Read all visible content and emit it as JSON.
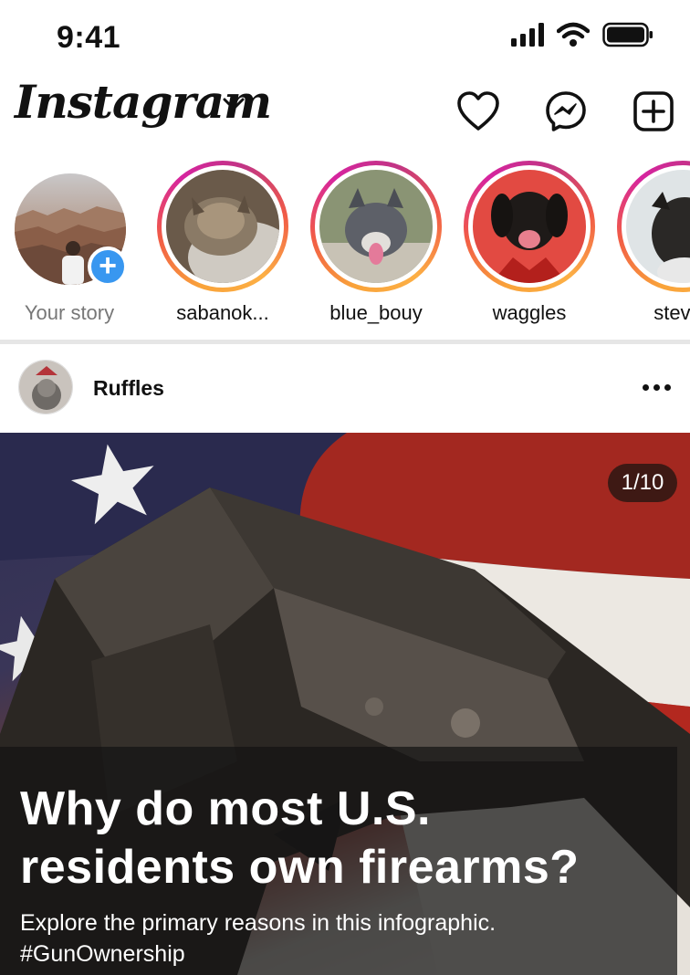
{
  "status_bar": {
    "time": "9:41"
  },
  "header": {
    "logo": "Instagram",
    "icons": [
      "heart-icon",
      "messenger-icon",
      "new-post-icon"
    ]
  },
  "stories": [
    {
      "label": "Your story",
      "own": true
    },
    {
      "label": "sabanok..."
    },
    {
      "label": "blue_bouy"
    },
    {
      "label": "waggles"
    },
    {
      "label": "steve.l"
    }
  ],
  "post": {
    "username": "Ruffles",
    "counter": "1/10",
    "caption_title_line1": "Why do most U.S.",
    "caption_title_line2": "residents own firearms?",
    "caption_sub_line1": "Explore the primary reasons in this infographic.",
    "caption_sub_line2": "#GunOwnership"
  },
  "colors": {
    "accent": "#3897f0",
    "ring_start": "#f9a33a",
    "ring_end": "#c13584"
  }
}
